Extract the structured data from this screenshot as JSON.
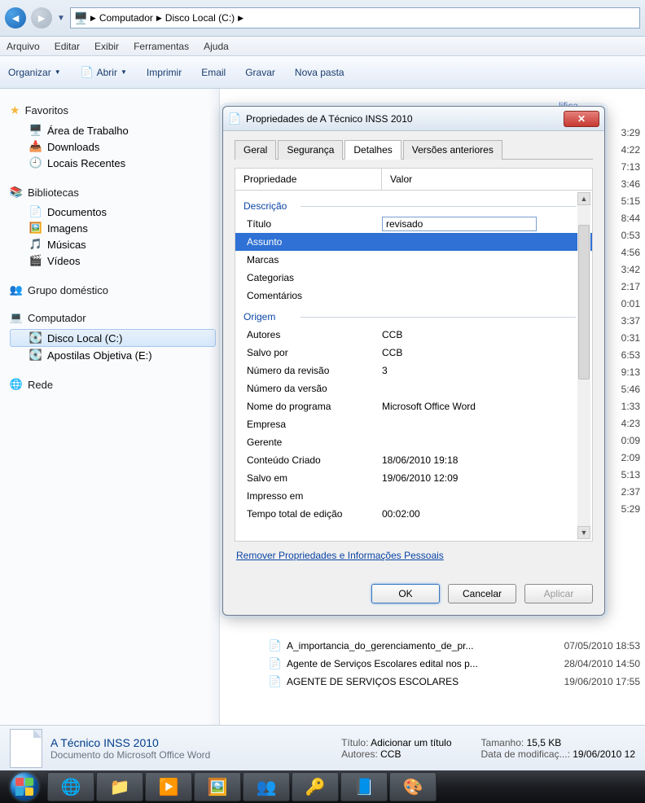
{
  "breadcrumb": {
    "root": "Computador",
    "drive": "Disco Local (C:)"
  },
  "menu": {
    "arquivo": "Arquivo",
    "editar": "Editar",
    "exibir": "Exibir",
    "ferramentas": "Ferramentas",
    "ajuda": "Ajuda"
  },
  "toolbar": {
    "organizar": "Organizar",
    "abrir": "Abrir",
    "imprimir": "Imprimir",
    "email": "Email",
    "gravar": "Gravar",
    "novapasta": "Nova pasta"
  },
  "sidebar": {
    "favoritos": "Favoritos",
    "desktop": "Área de Trabalho",
    "downloads": "Downloads",
    "recentes": "Locais Recentes",
    "bibliotecas": "Bibliotecas",
    "documentos": "Documentos",
    "imagens": "Imagens",
    "musicas": "Músicas",
    "videos": "Vídeos",
    "grupo": "Grupo doméstico",
    "computador": "Computador",
    "discoc": "Disco Local (C:)",
    "apostilas": "Apostilas Objetiva (E:)",
    "rede": "Rede"
  },
  "column_header": "lifica...",
  "times": [
    "3:29",
    "4:22",
    "7:13",
    "3:46",
    "5:15",
    "8:44",
    "0:53",
    "4:56",
    "3:42",
    "2:17",
    "0:01",
    "3:37",
    "0:31",
    "6:53",
    "9:13",
    "5:46",
    "1:33",
    "4:23",
    "0:09",
    "2:09",
    "5:13",
    "2:37",
    "5:29"
  ],
  "rows_below": [
    {
      "name": "A_importancia_do_gerenciamento_de_pr...",
      "date": "07/05/2010 18:53"
    },
    {
      "name": "Agente de Serviços Escolares edital nos p...",
      "date": "28/04/2010 14:50"
    },
    {
      "name": "AGENTE DE SERVIÇOS ESCOLARES",
      "date": "19/06/2010 17:55"
    }
  ],
  "details": {
    "filename": "A  Técnico INSS 2010",
    "type": "Documento do Microsoft Office Word",
    "titulo_label": "Título:",
    "titulo_val": "Adicionar um título",
    "autores_label": "Autores:",
    "autores_val": "CCB",
    "tamanho_label": "Tamanho:",
    "tamanho_val": "15,5 KB",
    "mod_label": "Data de modificaç...:",
    "mod_val": "19/06/2010 12"
  },
  "dialog": {
    "title": "Propriedades de A  Técnico INSS 2010",
    "tabs": {
      "geral": "Geral",
      "seguranca": "Segurança",
      "detalhes": "Detalhes",
      "versoes": "Versões anteriores"
    },
    "col_prop": "Propriedade",
    "col_val": "Valor",
    "sec_desc": "Descrição",
    "sec_orig": "Origem",
    "p_titulo": "Título",
    "v_titulo": "revisado",
    "p_assunto": "Assunto",
    "p_marcas": "Marcas",
    "p_categorias": "Categorias",
    "p_comentarios": "Comentários",
    "p_autores": "Autores",
    "v_autores": "CCB",
    "p_salvopor": "Salvo por",
    "v_salvopor": "CCB",
    "p_numrev": "Número da revisão",
    "v_numrev": "3",
    "p_numver": "Número da versão",
    "p_programa": "Nome do programa",
    "v_programa": "Microsoft Office Word",
    "p_empresa": "Empresa",
    "p_gerente": "Gerente",
    "p_criado": "Conteúdo Criado",
    "v_criado": "18/06/2010 19:18",
    "p_salvoem": "Salvo em",
    "v_salvoem": "19/06/2010 12:09",
    "p_impresso": "Impresso em",
    "p_tempo": "Tempo total de edição",
    "v_tempo": "00:02:00",
    "link_remover": "Remover Propriedades e Informações Pessoais",
    "btn_ok": "OK",
    "btn_cancel": "Cancelar",
    "btn_apply": "Aplicar"
  }
}
